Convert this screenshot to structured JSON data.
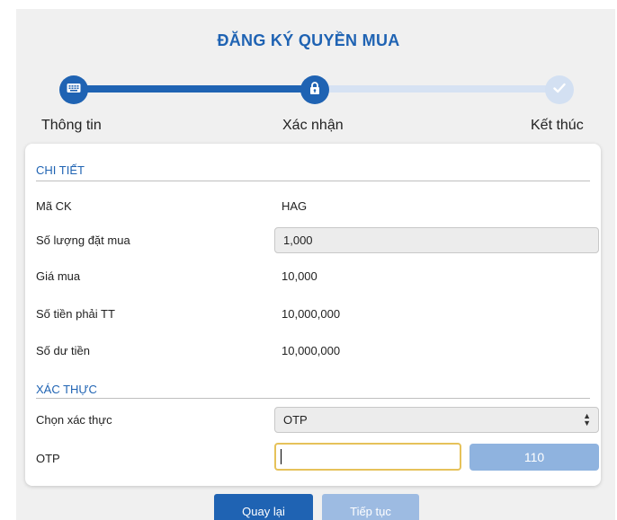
{
  "title": "ĐĂNG KÝ QUYỀN MUA",
  "steps": [
    {
      "label": "Thông tin",
      "icon": "keyboard-icon",
      "state": "done"
    },
    {
      "label": "Xác nhận",
      "icon": "lock-icon",
      "state": "current"
    },
    {
      "label": "Kết thúc",
      "icon": "check-icon",
      "state": "pending"
    }
  ],
  "details": {
    "section_title": "CHI TIẾT",
    "stock_code_label": "Mã CK",
    "stock_code_value": "HAG",
    "quantity_label": "Số lượng đặt mua",
    "quantity_value": "1,000",
    "price_label": "Giá mua",
    "price_value": "10,000",
    "amount_due_label": "Số tiền phải TT",
    "amount_due_value": "10,000,000",
    "balance_label": "Số dư tiền",
    "balance_value": "10,000,000"
  },
  "auth": {
    "section_title": "XÁC THỰC",
    "method_label": "Chọn xác thực",
    "method_value": "OTP",
    "otp_label": "OTP",
    "otp_value": "",
    "countdown": "110"
  },
  "buttons": {
    "back": "Quay lại",
    "next": "Tiếp tục"
  },
  "colors": {
    "accent": "#1f63b3",
    "inactive": "#d3e0f2",
    "disabled_button": "#9dbbe2",
    "otp_focus": "#e6c25a"
  }
}
